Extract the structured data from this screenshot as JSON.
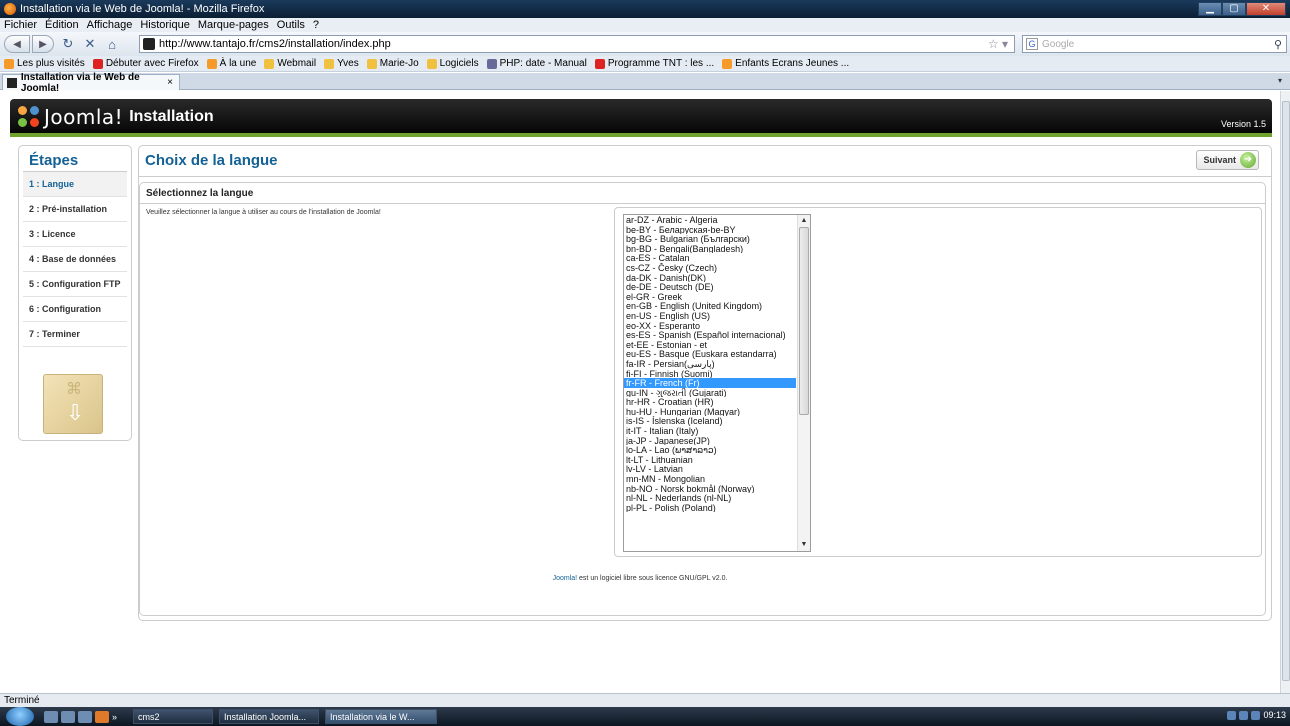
{
  "browser": {
    "window_title": "Installation via le Web de Joomla! - Mozilla Firefox",
    "menu": [
      "Fichier",
      "Édition",
      "Affichage",
      "Historique",
      "Marque-pages",
      "Outils",
      "?"
    ],
    "url": "http://www.tantajo.fr/cms2/installation/index.php",
    "search_placeholder": "Google",
    "bookmarks": [
      {
        "label": "Les plus visités",
        "icon": "rss"
      },
      {
        "label": "Débuter avec Firefox",
        "icon": "red"
      },
      {
        "label": "À la une",
        "icon": "rss"
      },
      {
        "label": "Webmail",
        "icon": "folder"
      },
      {
        "label": "Yves",
        "icon": "folder"
      },
      {
        "label": "Marie-Jo",
        "icon": "folder"
      },
      {
        "label": "Logiciels",
        "icon": "folder"
      },
      {
        "label": "PHP: date - Manual",
        "icon": "purple"
      },
      {
        "label": "Programme TNT : les ...",
        "icon": "red"
      },
      {
        "label": "Enfants Ecrans Jeunes ...",
        "icon": "rss"
      }
    ],
    "tab_label": "Installation via le Web de Joomla!",
    "status": "Terminé"
  },
  "joomla": {
    "logo_text": "Joomla!",
    "header_title": "Installation",
    "version": "Version 1.5",
    "steps_title": "Étapes",
    "steps": [
      {
        "label": "1 : Langue",
        "active": true
      },
      {
        "label": "2 : Pré-installation",
        "active": false
      },
      {
        "label": "3 : Licence",
        "active": false
      },
      {
        "label": "4 : Base de données",
        "active": false
      },
      {
        "label": "5 : Configuration FTP",
        "active": false
      },
      {
        "label": "6 : Configuration",
        "active": false
      },
      {
        "label": "7 : Terminer",
        "active": false
      }
    ],
    "page_title": "Choix de la langue",
    "next_label": "Suivant",
    "section_title": "Sélectionnez la langue",
    "description": "Veuillez sélectionner la langue à utiliser au cours de l'installation de Joomla!",
    "languages": [
      "ar-DZ - Arabic - Algeria",
      "be-BY - Беларуская-be-BY",
      "bg-BG - Bulgarian (Български)",
      "bn-BD - Bengali(Bangladesh)",
      "ca-ES - Catalan",
      "cs-CZ - Česky (Czech)",
      "da-DK - Danish(DK)",
      "de-DE - Deutsch (DE)",
      "el-GR - Greek",
      "en-GB - English (United Kingdom)",
      "en-US - English (US)",
      "eo-XX - Esperanto",
      "es-ES - Spanish (Español internacional)",
      "et-EE - Estonian - et",
      "eu-ES - Basque (Euskara estandarra)",
      "fa-IR - Persian(پارسی)",
      "fi-FI - Finnish (Suomi)",
      "fr-FR - French (Fr)",
      "gu-IN - ગુજરાતી (Gujarati)",
      "hr-HR - Croatian (HR)",
      "hu-HU - Hungarian (Magyar)",
      "is-IS - Íslenska (Iceland)",
      "it-IT - Italian (Italy)",
      "ja-JP - Japanese(JP)",
      "lo-LA - Lao (ພາສາລາວ)",
      "lt-LT - Lithuanian",
      "lv-LV - Latvian",
      "mn-MN - Mongolian",
      "nb-NO - Norsk bokmål (Norway)",
      "nl-NL - Nederlands (nl-NL)",
      "pl-PL - Polish (Poland)"
    ],
    "selected_language": "fr-FR - French (Fr)",
    "footer_link": "Joomla!",
    "footer_text": " est un logiciel libre sous licence GNU/GPL v2.0."
  },
  "taskbar": {
    "items": [
      {
        "label": "cms2",
        "active": false
      },
      {
        "label": "Installation Joomla...",
        "active": false
      },
      {
        "label": "Installation via le W...",
        "active": true
      }
    ],
    "clock": "09:13"
  },
  "colors": {
    "joomla_blue": "#146295",
    "joomla_green": "#6fa32e",
    "selection": "#3399ff"
  }
}
